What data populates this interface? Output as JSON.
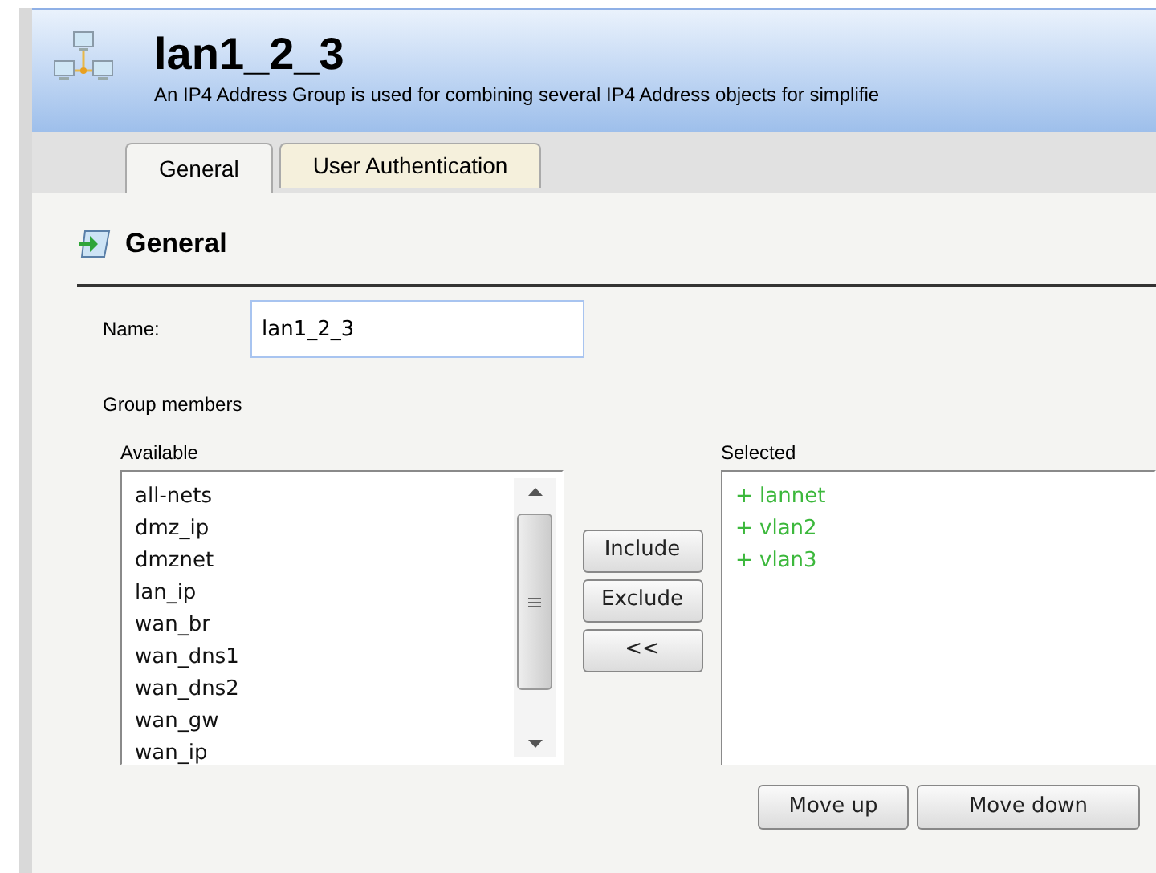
{
  "header": {
    "title": "lan1_2_3",
    "description": "An IP4 Address Group is used for combining several IP4 Address objects for simplifie"
  },
  "tabs": [
    {
      "label": "General",
      "selected": true
    },
    {
      "label": "User Authentication",
      "selected": false
    }
  ],
  "section": {
    "title": "General"
  },
  "name_field": {
    "label": "Name:",
    "value": "lan1_2_3"
  },
  "group_members": {
    "label": "Group members",
    "available": {
      "label": "Available",
      "items": [
        "all-nets",
        "dmz_ip",
        "dmznet",
        "lan_ip",
        "wan_br",
        "wan_dns1",
        "wan_dns2",
        "wan_gw",
        "wan_ip"
      ]
    },
    "buttons": [
      "Include",
      "Exclude",
      "<<"
    ],
    "selected": {
      "label": "Selected",
      "items": [
        "+ lannet",
        "+ vlan2",
        "+ vlan3"
      ]
    },
    "order_buttons": [
      "Move up",
      "Move down"
    ]
  }
}
